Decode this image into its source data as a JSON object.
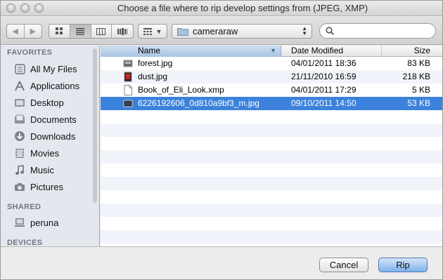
{
  "window": {
    "title": "Choose a file where to rip develop settings from (JPEG, XMP)"
  },
  "toolbar": {
    "location": "cameraraw",
    "search_placeholder": ""
  },
  "sidebar": {
    "favorites_label": "FAVORITES",
    "shared_label": "SHARED",
    "devices_label": "DEVICES",
    "favorites": [
      {
        "label": "All My Files",
        "icon": "all-files-icon"
      },
      {
        "label": "Applications",
        "icon": "applications-icon"
      },
      {
        "label": "Desktop",
        "icon": "desktop-icon"
      },
      {
        "label": "Documents",
        "icon": "documents-icon"
      },
      {
        "label": "Downloads",
        "icon": "downloads-icon"
      },
      {
        "label": "Movies",
        "icon": "movies-icon"
      },
      {
        "label": "Music",
        "icon": "music-icon"
      },
      {
        "label": "Pictures",
        "icon": "pictures-icon"
      }
    ],
    "shared": [
      {
        "label": "peruna",
        "icon": "computer-icon"
      }
    ]
  },
  "columns": {
    "name": "Name",
    "date": "Date Modified",
    "size": "Size"
  },
  "files": [
    {
      "name": "forest.jpg",
      "date": "04/01/2011 18:36",
      "size": "83 KB",
      "selected": false
    },
    {
      "name": "dust.jpg",
      "date": "21/11/2010 16:59",
      "size": "218 KB",
      "selected": false
    },
    {
      "name": "Book_of_Eli_Look.xmp",
      "date": "04/01/2011 17:29",
      "size": "5 KB",
      "selected": false
    },
    {
      "name": "6226192606_0d810a9bf3_m.jpg",
      "date": "09/10/2011 14:50",
      "size": "53 KB",
      "selected": true
    }
  ],
  "buttons": {
    "cancel": "Cancel",
    "rip": "Rip"
  },
  "colors": {
    "selection": "#3c82dc",
    "accent_button": "#7fb1ec",
    "sidebar_bg": "#e4e8ee"
  }
}
